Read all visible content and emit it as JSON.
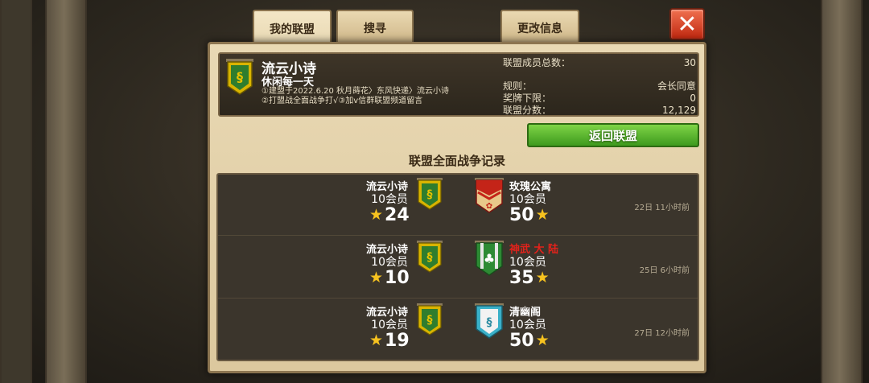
{
  "tabs": [
    {
      "label": "我的联盟",
      "active": true
    },
    {
      "label": "搜寻",
      "active": false
    },
    {
      "label": "更改信息",
      "active": false
    }
  ],
  "alliance": {
    "name": "流云小诗",
    "motto": "休闲每一天",
    "description": "①建盟于2022.6.20 秋月蒔花〉东风快递〉流云小诗 ②打盟战全面战争打√③加v信群联盟频道留言",
    "stats": {
      "members_label": "联盟成员总数：",
      "members_value": "30",
      "rule_label": "规则：",
      "rule_value": "会长同意",
      "medal_label": "奖牌下限：",
      "medal_value": "0",
      "score_label": "联盟分数：",
      "score_value": "12,129"
    }
  },
  "return_button": "返回联盟",
  "section_title": "联盟全面战争记录",
  "records": [
    {
      "left_name": "流云小诗",
      "left_members": "10会员",
      "left_score": "24",
      "right_name": "玫瑰公寓",
      "right_members": "10会员",
      "right_score": "50",
      "right_name_color": "white",
      "right_banner": "red-chevron",
      "time": "22日 11小时前"
    },
    {
      "left_name": "流云小诗",
      "left_members": "10会员",
      "left_score": "10",
      "right_name": "神武 大 陆",
      "right_members": "10会员",
      "right_score": "35",
      "right_name_color": "red",
      "right_banner": "green-clover",
      "time": "25日 6小时前"
    },
    {
      "left_name": "流云小诗",
      "left_members": "10会员",
      "left_score": "19",
      "right_name": "清幽阁",
      "right_members": "10会员",
      "right_score": "50",
      "right_name_color": "white",
      "right_banner": "cyan-dragon",
      "time": "27日 12小时前"
    }
  ],
  "colors": {
    "accent_green": "#4aa824",
    "close_red": "#d83a1c",
    "star_gold": "#f6c21f",
    "enemy_name_red": "#e3221b"
  }
}
